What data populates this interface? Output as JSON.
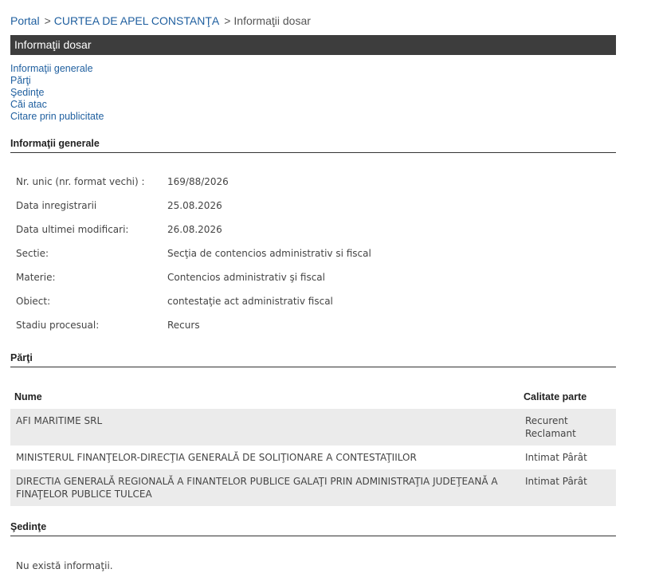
{
  "breadcrumb": {
    "portal": "Portal",
    "sep1": ">",
    "court": "CURTEA DE APEL CONSTANŢA",
    "sep2": ">",
    "current": "Informaţii dosar"
  },
  "title_bar": "Informaţii dosar",
  "nav": {
    "general": "Informaţii generale",
    "parties": "Părţi",
    "hearings": "Şedinţe",
    "appeals": "Căi atac",
    "publicity": "Citare prin publicitate"
  },
  "general_section": {
    "header": "Informaţii generale",
    "rows": [
      {
        "label": "Nr. unic (nr. format vechi) :",
        "value": "169/88/2026"
      },
      {
        "label": "Data inregistrarii",
        "value": "25.08.2026"
      },
      {
        "label": "Data ultimei modificari:",
        "value": "26.08.2026"
      },
      {
        "label": "Sectie:",
        "value": "Secţia de contencios administrativ si fiscal"
      },
      {
        "label": "Materie:",
        "value": "Contencios administrativ şi fiscal"
      },
      {
        "label": "Obiect:",
        "value": "contestaţie act administrativ fiscal"
      },
      {
        "label": "Stadiu procesual:",
        "value": "Recurs"
      }
    ]
  },
  "parties_section": {
    "header": "Părţi",
    "columns": {
      "name": "Nume",
      "role": "Calitate parte"
    },
    "rows": [
      {
        "name": "AFI MARITIME SRL",
        "role_line1": "Recurent",
        "role_line2": "Reclamant"
      },
      {
        "name": "MINISTERUL FINANŢELOR-DIRECŢIA GENERALĂ DE SOLIŢIONARE A CONTESTAŢIILOR",
        "role_line1": "Intimat Pârât",
        "role_line2": ""
      },
      {
        "name": "DIRECTIA GENERALĂ REGIONALĂ A FINANTELOR PUBLICE GALAŢI PRIN ADMINISTRAŢIA JUDEŢEANĂ A FINAŢELOR PUBLICE TULCEA",
        "role_line1": "Intimat Pârât",
        "role_line2": ""
      }
    ]
  },
  "hearings_section": {
    "header": "Şedinţe",
    "empty_text": "Nu există informaţii."
  },
  "colors": {
    "link": "#1f5f9f",
    "title_bar_bg": "#3d3d3d",
    "row_shade": "#ebebeb"
  }
}
